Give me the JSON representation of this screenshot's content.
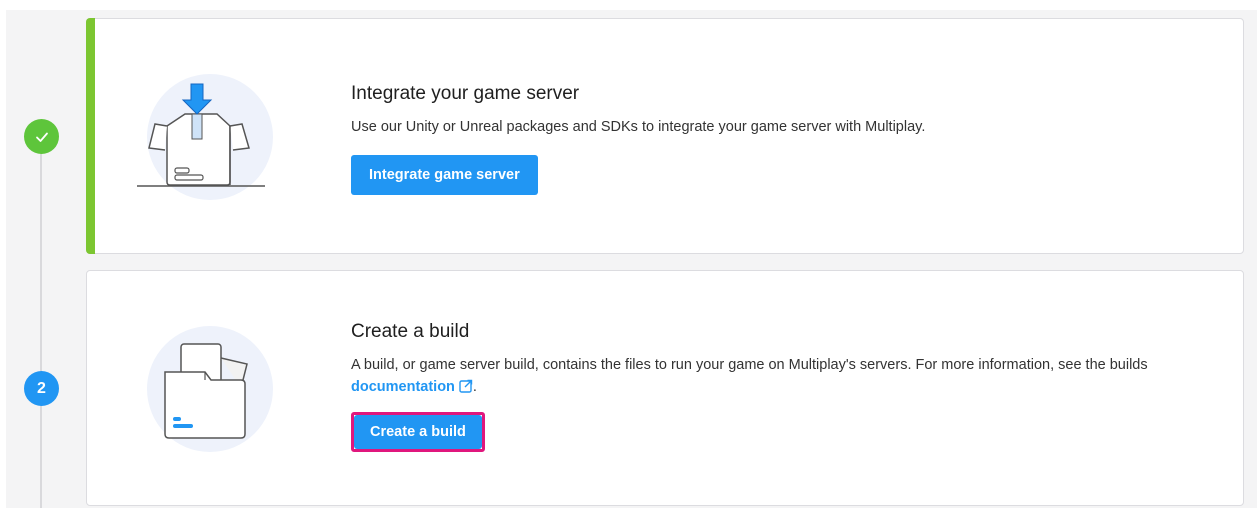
{
  "steps": [
    {
      "status": "complete",
      "badge": "",
      "title": "Integrate your game server",
      "description": "Use our Unity or Unreal packages and SDKs to integrate your game server with Multiplay.",
      "button_label": "Integrate game server",
      "illustration": "box-with-download-arrow-icon"
    },
    {
      "status": "pending",
      "badge": "2",
      "title": "Create a build",
      "description_before": "A build, or game server build, contains the files to run your game on Multiplay's servers. For more information, see the builds",
      "link_text": "documentation",
      "description_after": ".",
      "button_label": "Create a build",
      "illustration": "folder-icon"
    }
  ],
  "colors": {
    "accent": "#2196f3",
    "complete": "#5ec53b",
    "complete_bar": "#7cc631",
    "highlight": "#e0177d"
  }
}
